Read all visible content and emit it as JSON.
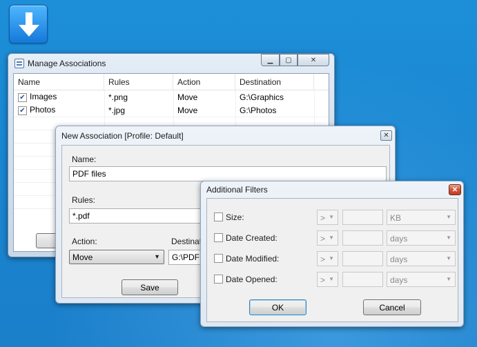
{
  "desktop": {
    "icon": "download-arrow-icon"
  },
  "manage_window": {
    "title": "Manage Associations",
    "caption_buttons": [
      "minimize-icon",
      "maximize-icon",
      "close-icon"
    ],
    "columns": [
      "Name",
      "Rules",
      "Action",
      "Destination"
    ],
    "rows": [
      {
        "checked": true,
        "name": "Images",
        "rules": "*.png",
        "action": "Move",
        "destination": "G:\\Graphics"
      },
      {
        "checked": true,
        "name": "Photos",
        "rules": "*.jpg",
        "action": "Move",
        "destination": "G:\\Photos"
      }
    ]
  },
  "new_window": {
    "title": "New Association [Profile: Default]",
    "name_label": "Name:",
    "name_value": "PDF files",
    "rules_label": "Rules:",
    "rules_value": "*.pdf",
    "action_label": "Action:",
    "action_value": "Move",
    "destination_label": "Destinati",
    "destination_value": "G:\\PDF",
    "save_label": "Save"
  },
  "filters_window": {
    "title": "Additional Filters",
    "rows": [
      {
        "label": "Size:",
        "operator": ">",
        "unit": "KB"
      },
      {
        "label": "Date Created:",
        "operator": ">",
        "unit": "days"
      },
      {
        "label": "Date Modified:",
        "operator": ">",
        "unit": "days"
      },
      {
        "label": "Date Opened:",
        "operator": ">",
        "unit": "days"
      }
    ],
    "ok_label": "OK",
    "cancel_label": "Cancel"
  }
}
